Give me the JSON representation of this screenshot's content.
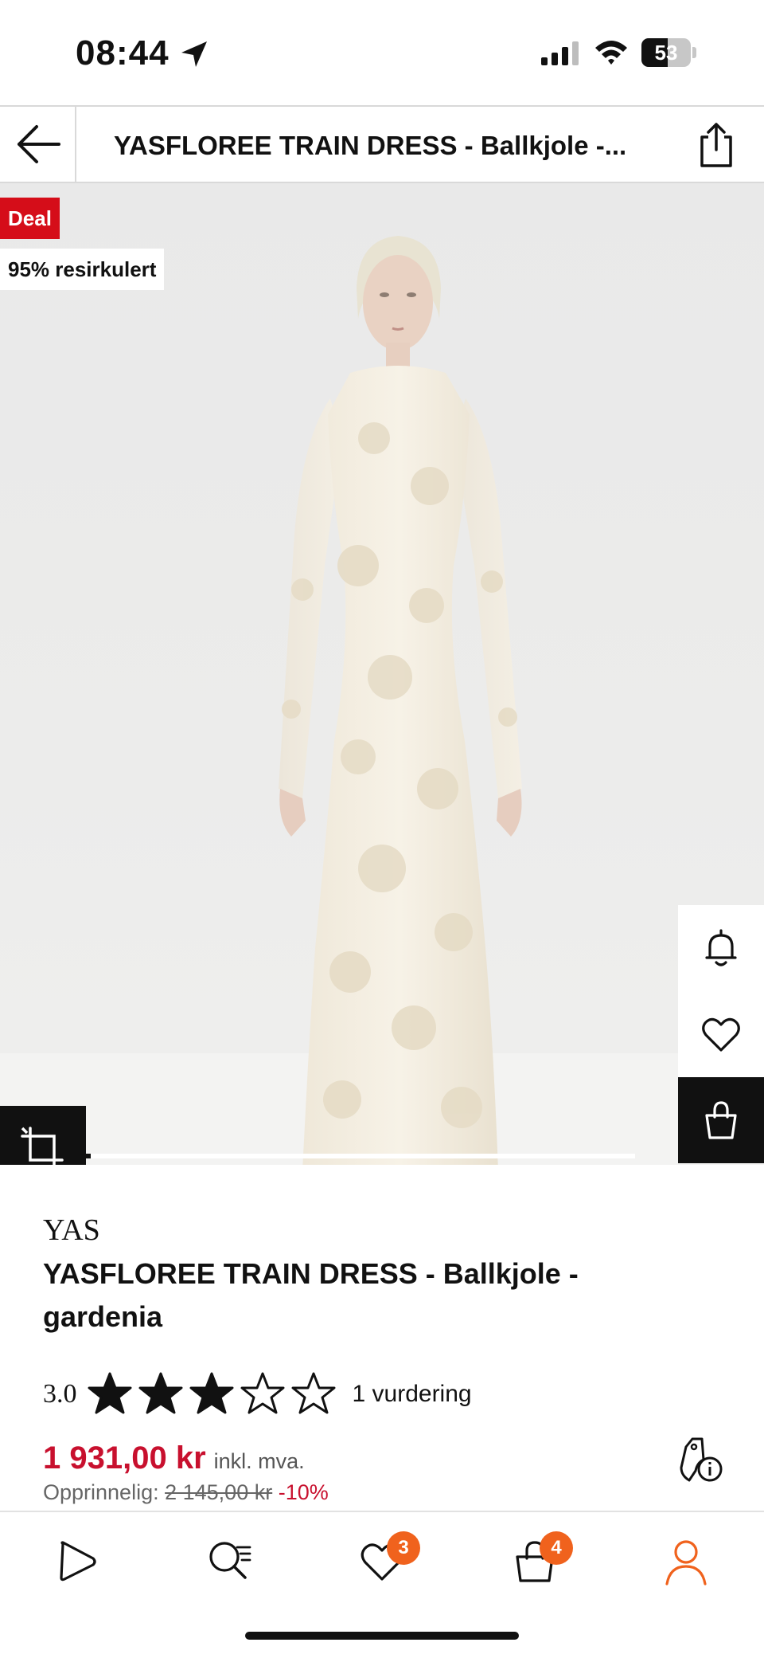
{
  "status_bar": {
    "time": "08:44",
    "battery": "53",
    "battery_level": 0.53
  },
  "header": {
    "title": "YASFLOREE TRAIN DRESS - Ballkjole -..."
  },
  "hero": {
    "badges": {
      "deal": "Deal",
      "recycled": "95% resirkulert"
    }
  },
  "product": {
    "brand": "YAS",
    "name": "YASFLOREE TRAIN DRESS - Ballkjole - gardenia",
    "rating": "3.0",
    "rating_value": 3,
    "rating_max": 5,
    "rating_count": "1 vurdering",
    "price": "1 931,00 kr",
    "vat": "inkl. mva.",
    "original_label": "Opprinnelig:",
    "original_price": "2 145,00 kr",
    "discount": "-10%"
  },
  "tabbar": {
    "wishlist_badge": "3",
    "bag_badge": "4"
  },
  "colors": {
    "accent": "#f0621d",
    "sale": "#c8102e",
    "deal_badge": "#d50d19"
  }
}
